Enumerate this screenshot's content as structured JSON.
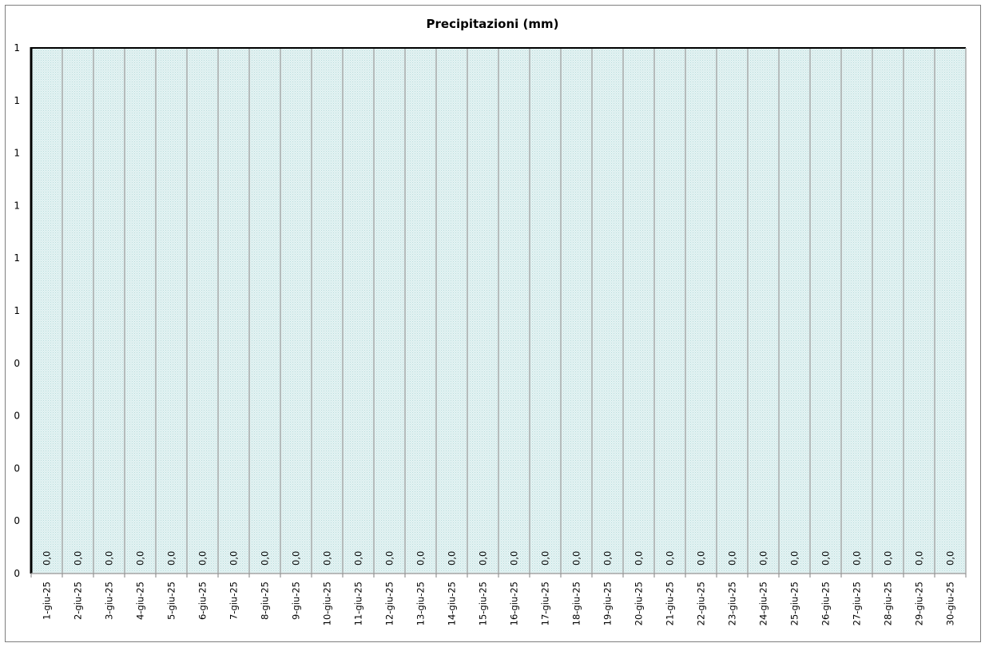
{
  "chart_data": {
    "type": "bar",
    "title": "Precipitazioni  (mm)",
    "xlabel": "",
    "ylabel": "",
    "ylim": [
      0,
      1
    ],
    "y_tick_labels": [
      "0",
      "0",
      "0",
      "0",
      "0",
      "1",
      "1",
      "1",
      "1",
      "1",
      "1"
    ],
    "categories": [
      "1-giu-25",
      "2-giu-25",
      "3-giu-25",
      "4-giu-25",
      "5-giu-25",
      "6-giu-25",
      "7-giu-25",
      "8-giu-25",
      "9-giu-25",
      "10-giu-25",
      "11-giu-25",
      "12-giu-25",
      "13-giu-25",
      "14-giu-25",
      "15-giu-25",
      "16-giu-25",
      "17-giu-25",
      "18-giu-25",
      "19-giu-25",
      "20-giu-25",
      "21-giu-25",
      "22-giu-25",
      "23-giu-25",
      "24-giu-25",
      "25-giu-25",
      "26-giu-25",
      "27-giu-25",
      "28-giu-25",
      "29-giu-25",
      "30-giu-25"
    ],
    "values": [
      0,
      0,
      0,
      0,
      0,
      0,
      0,
      0,
      0,
      0,
      0,
      0,
      0,
      0,
      0,
      0,
      0,
      0,
      0,
      0,
      0,
      0,
      0,
      0,
      0,
      0,
      0,
      0,
      0,
      0
    ],
    "data_labels": [
      "0,0",
      "0,0",
      "0,0",
      "0,0",
      "0,0",
      "0,0",
      "0,0",
      "0,0",
      "0,0",
      "0,0",
      "0,0",
      "0,0",
      "0,0",
      "0,0",
      "0,0",
      "0,0",
      "0,0",
      "0,0",
      "0,0",
      "0,0",
      "0,0",
      "0,0",
      "0,0",
      "0,0",
      "0,0",
      "0,0",
      "0,0",
      "0,0",
      "0,0",
      "0,0"
    ],
    "grid": true,
    "legend": "none",
    "colors": {
      "plot_fill": "#dcefef",
      "gridline": "#a6a6a6",
      "axis": "#000000",
      "border": "#7f7f7f"
    }
  }
}
